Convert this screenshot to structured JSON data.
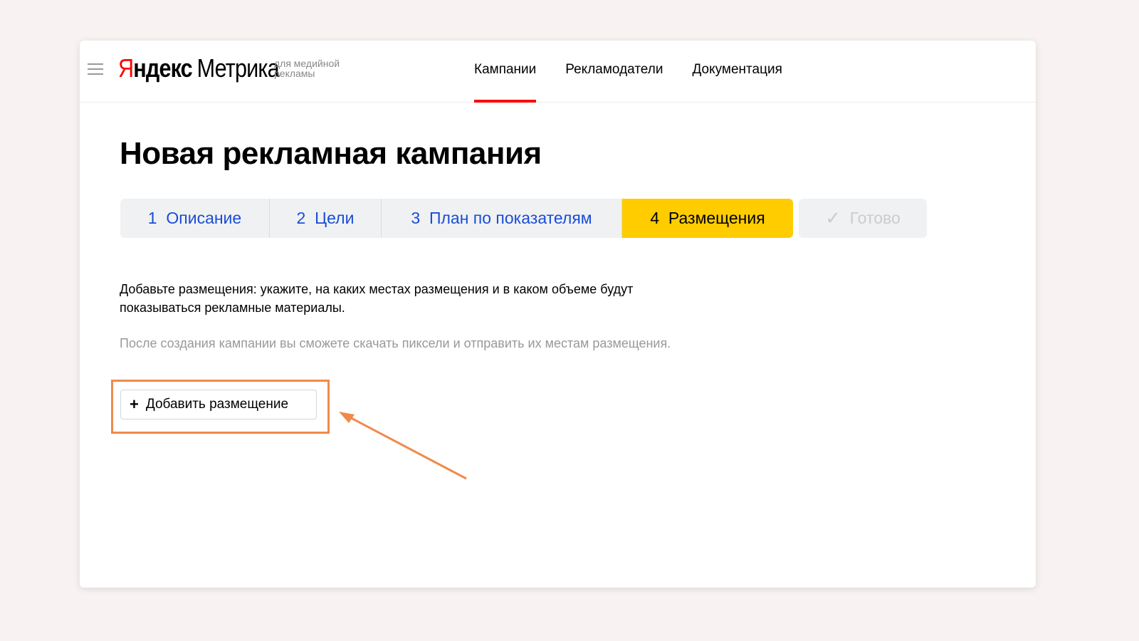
{
  "header": {
    "logo": {
      "brand_first": "Я",
      "brand_rest": "ндекс",
      "product": "Метрика",
      "subtitle": "для медийной рекламы"
    },
    "nav": [
      {
        "label": "Кампании",
        "active": true
      },
      {
        "label": "Рекламодатели"
      },
      {
        "label": "Документация"
      }
    ]
  },
  "page": {
    "title": "Новая рекламная кампания",
    "steps": [
      {
        "num": "1",
        "label": "Описание"
      },
      {
        "num": "2",
        "label": "Цели"
      },
      {
        "num": "3",
        "label": "План по показателям"
      },
      {
        "num": "4",
        "label": "Размещения"
      },
      {
        "label": "Готово",
        "icon": "check-icon"
      }
    ],
    "description": "Добавьте размещения: укажите, на каких местах размещения и в каком объеме будут показываться рекламные материалы.",
    "note": "После создания кампании вы сможете скачать пиксели и отправить их местам размещения.",
    "add_button": "Добавить размещение"
  },
  "colors": {
    "accent": "#ffcc00",
    "nav_active": "#ff0000",
    "link": "#1a4dd6",
    "annotation": "#f08a4b"
  }
}
